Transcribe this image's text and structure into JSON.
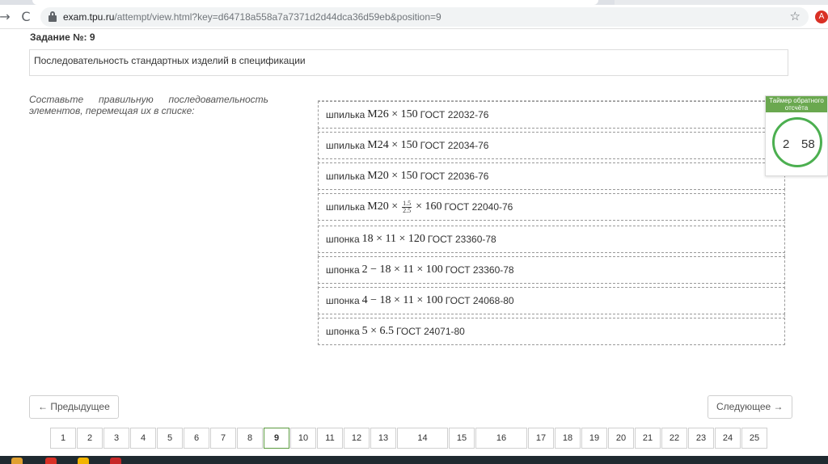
{
  "browser": {
    "url_host": "exam.tpu.ru",
    "url_path": "/attempt/view.html?key=d64718a558a7a7371d2d44dca36d59eb&position=9",
    "avatar_letter": "A",
    "back_icon": "→",
    "reload_icon": "C",
    "star_icon": "☆"
  },
  "task": {
    "label": "Задание №:",
    "number": "9",
    "question": "Последовательность стандартных изделий в спецификации",
    "instruction": "Составьте правильную последовательность элементов, перемещая их в списке:"
  },
  "items": [
    {
      "prefix": "шпилька",
      "math": "M26 × 150",
      "suffix": "ГОСТ 22032-76"
    },
    {
      "prefix": "шпилька",
      "math": "M24 × 150",
      "suffix": "ГОСТ 22034-76"
    },
    {
      "prefix": "шпилька",
      "math": "M20 × 150",
      "suffix": "ГОСТ 22036-76"
    },
    {
      "prefix": "шпилька",
      "math_a": "M20 ×",
      "frac_num": "1.5",
      "frac_den": "2.5",
      "math_b": "× 160",
      "suffix": "ГОСТ 22040-76"
    },
    {
      "prefix": "шпонка",
      "math": "18 × 11 × 120",
      "suffix": "ГОСТ 23360-78"
    },
    {
      "prefix": "шпонка",
      "math": "2 − 18 × 11 × 100",
      "suffix": "ГОСТ 23360-78"
    },
    {
      "prefix": "шпонка",
      "math": "4 − 18 × 11 × 100",
      "suffix": "ГОСТ 24068-80"
    },
    {
      "prefix": "шпонка",
      "math": "5 × 6.5",
      "suffix": "ГОСТ 24071-80"
    }
  ],
  "timer": {
    "title": "Таймер обратного отсчёта",
    "minutes": "2",
    "seconds": "58",
    "color": "#4caf50"
  },
  "navigation": {
    "prev_label": "← Предыдущее",
    "next_label": "Следующее →"
  },
  "pages": [
    "1",
    "2",
    "3",
    "4",
    "5",
    "6",
    "7",
    "8",
    "9",
    "10",
    "11",
    "12",
    "13",
    "14",
    "15",
    "16",
    "17",
    "18",
    "19",
    "20",
    "21",
    "22",
    "23",
    "24",
    "25"
  ],
  "current_page": "9",
  "colors": {
    "accent_green": "#6aa84f",
    "avatar_red": "#d93025"
  }
}
